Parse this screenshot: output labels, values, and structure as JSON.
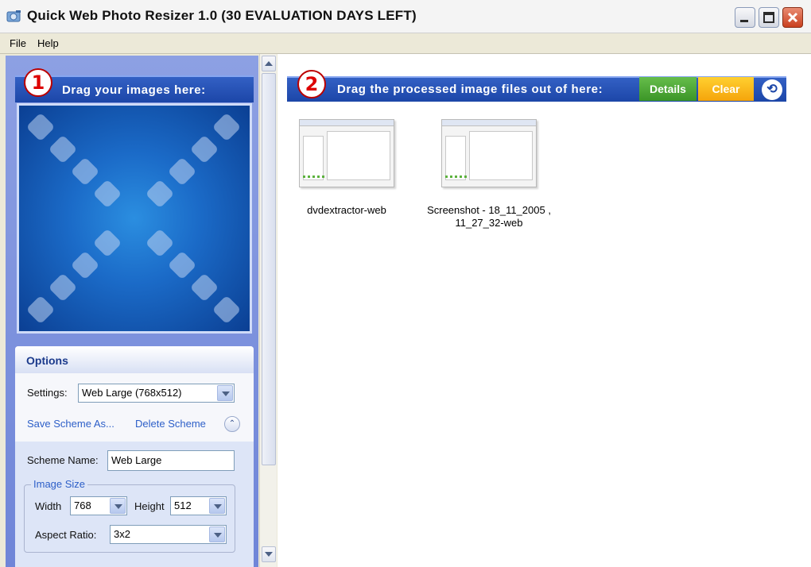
{
  "window": {
    "title": "Quick Web Photo Resizer 1.0 (30 EVALUATION DAYS LEFT)"
  },
  "menu": {
    "items": [
      "File",
      "Help"
    ]
  },
  "input_panel": {
    "step_number": "1",
    "drag_label": "Drag your images here:"
  },
  "options": {
    "title": "Options",
    "settings_label": "Settings:",
    "settings_value": "Web Large (768x512)",
    "save_scheme": "Save Scheme As...",
    "delete_scheme": "Delete Scheme",
    "scheme_name_label": "Scheme Name:",
    "scheme_name_value": "Web Large",
    "image_size_group": "Image Size",
    "width_label": "Width",
    "width_value": "768",
    "height_label": "Height",
    "height_value": "512",
    "aspect_label": "Aspect Ratio:",
    "aspect_value": "3x2"
  },
  "output_panel": {
    "step_number": "2",
    "drag_label": "Drag the processed image files out of here:",
    "details_button": "Details",
    "clear_button": "Clear",
    "refresh_icon": "refresh-icon",
    "files": [
      {
        "name_line1": "dvdextractor-web",
        "name_line2": ""
      },
      {
        "name_line1": "Screenshot - 18_11_2005 ,",
        "name_line2": "11_27_32-web"
      }
    ]
  },
  "colors": {
    "header_blue": "#1c46a8",
    "details_green": "#3b9527",
    "clear_orange": "#f5a40b",
    "badge_red": "#d00000"
  }
}
